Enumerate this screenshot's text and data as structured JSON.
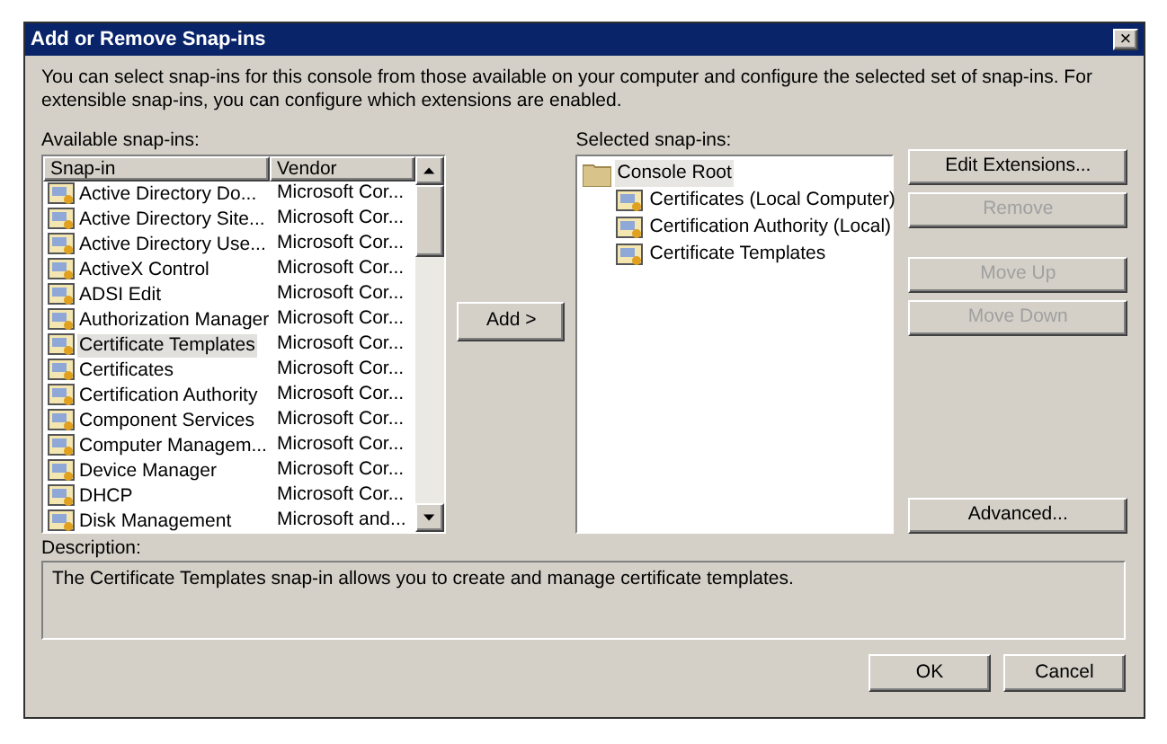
{
  "window": {
    "title": "Add or Remove Snap-ins",
    "close": "×"
  },
  "intro": "You can select snap-ins for this console from those available on your computer and configure the selected set of snap-ins. For extensible snap-ins, you can configure which extensions are enabled.",
  "available": {
    "label": "Available snap-ins:",
    "columns": [
      "Snap-in",
      "Vendor"
    ],
    "rows": [
      {
        "name": "Active Directory Do...",
        "vendor": "Microsoft Cor...",
        "selected": false
      },
      {
        "name": "Active Directory Site...",
        "vendor": "Microsoft Cor...",
        "selected": false
      },
      {
        "name": "Active Directory Use...",
        "vendor": "Microsoft Cor...",
        "selected": false
      },
      {
        "name": "ActiveX Control",
        "vendor": "Microsoft Cor...",
        "selected": false
      },
      {
        "name": "ADSI Edit",
        "vendor": "Microsoft Cor...",
        "selected": false
      },
      {
        "name": "Authorization Manager",
        "vendor": "Microsoft Cor...",
        "selected": false
      },
      {
        "name": "Certificate Templates",
        "vendor": "Microsoft Cor...",
        "selected": true
      },
      {
        "name": "Certificates",
        "vendor": "Microsoft Cor...",
        "selected": false
      },
      {
        "name": "Certification Authority",
        "vendor": "Microsoft Cor...",
        "selected": false
      },
      {
        "name": "Component Services",
        "vendor": "Microsoft Cor...",
        "selected": false
      },
      {
        "name": "Computer Managem...",
        "vendor": "Microsoft Cor...",
        "selected": false
      },
      {
        "name": "Device Manager",
        "vendor": "Microsoft Cor...",
        "selected": false
      },
      {
        "name": "DHCP",
        "vendor": "Microsoft Cor...",
        "selected": false
      },
      {
        "name": "Disk Management",
        "vendor": "Microsoft and...",
        "selected": false
      }
    ]
  },
  "add_button": "Add >",
  "selected_snapins": {
    "label": "Selected snap-ins:",
    "tree": [
      {
        "name": "Console Root",
        "kind": "folder",
        "selected": true,
        "children": [
          {
            "name": "Certificates (Local Computer)",
            "kind": "snapin",
            "selected": false
          },
          {
            "name": "Certification Authority (Local)",
            "kind": "snapin",
            "selected": false
          },
          {
            "name": "Certificate Templates",
            "kind": "snapin",
            "selected": false
          }
        ]
      }
    ]
  },
  "side_button_groups": [
    [
      {
        "label": "Edit Extensions...",
        "disabled": false
      },
      {
        "label": "Remove",
        "disabled": true
      }
    ],
    [
      {
        "label": "Move Up",
        "disabled": true
      },
      {
        "label": "Move Down",
        "disabled": true
      }
    ],
    [
      {
        "label": "Advanced...",
        "disabled": false
      }
    ]
  ],
  "description": {
    "label": "Description:",
    "text": "The Certificate Templates snap-in allows you to create and manage certificate templates."
  },
  "buttons": [
    {
      "label": "OK"
    },
    {
      "label": "Cancel"
    }
  ]
}
